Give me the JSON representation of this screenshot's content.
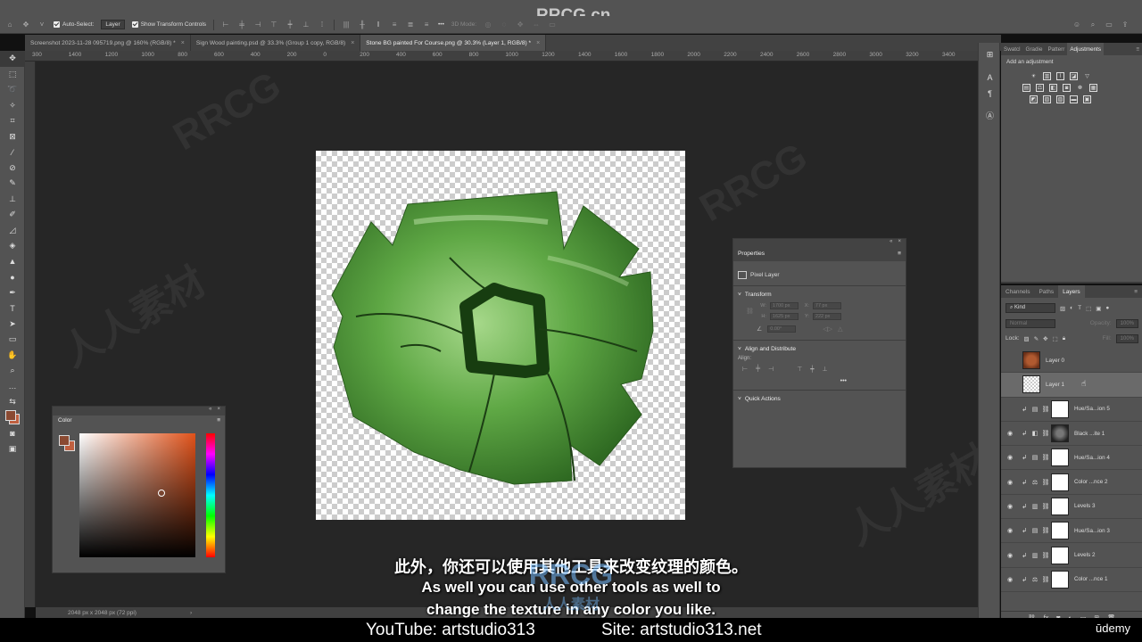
{
  "watermark": {
    "top": "RRCG.cn",
    "center_line1": "RRCG",
    "center_line2": "人人素材",
    "diag": "RRCG",
    "diag_cn": "人人素材"
  },
  "options_bar": {
    "auto_select_label": "Auto-Select:",
    "auto_select_value": "Layer",
    "show_transform_label": "Show Transform Controls",
    "three_d_mode": "3D Mode:",
    "more": "•••"
  },
  "tabs": [
    {
      "label": "Screenshot 2023-11-28 095719.png @ 160% (RGB/8) *",
      "close": "×"
    },
    {
      "label": "Sign Wood painting.psd @ 33.3% (Group 1 copy, RGB/8)",
      "close": "×"
    },
    {
      "label": "Stone BG painted For Course.png @ 30.3% (Layer 1, RGB/8) *",
      "close": "×"
    }
  ],
  "ruler_ticks": [
    "300",
    "1400",
    "1200",
    "1000",
    "800",
    "600",
    "400",
    "200",
    "0",
    "200",
    "400",
    "600",
    "800",
    "1000",
    "1200",
    "1400",
    "1600",
    "1800",
    "2000",
    "2200",
    "2400",
    "2600",
    "2800",
    "3000",
    "3200",
    "3400"
  ],
  "status": {
    "doc_size": "2048 px x 2048 px (72 ppi)",
    "arrow": "›"
  },
  "color_panel": {
    "title": "Color",
    "collapse": "«",
    "close": "×",
    "menu": "≡"
  },
  "properties": {
    "title": "Properties",
    "pixel_layer": "Pixel Layer",
    "transform": "Transform",
    "w_label": "W:",
    "w_value": "1700 px",
    "x_label": "X:",
    "x_value": "77 px",
    "h_label": "H:",
    "h_value": "1625 px",
    "y_label": "Y:",
    "y_value": "222 px",
    "angle_value": "0.00°",
    "align_distribute": "Align and Distribute",
    "align_label": "Align:",
    "more": "•••",
    "quick_actions": "Quick Actions",
    "collapse": "«",
    "close": "×",
    "menu": "≡"
  },
  "adjustments": {
    "tabs": [
      "Swatcl",
      "Gradie",
      "Patterr",
      "Adjustments"
    ],
    "add_label": "Add an adjustment",
    "menu": "≡"
  },
  "layers": {
    "tabs": [
      "Channels",
      "Paths",
      "Layers"
    ],
    "filter_kind": "Kind",
    "blend_mode": "Normal",
    "opacity_label": "Opacity:",
    "opacity_value": "100%",
    "lock_label": "Lock:",
    "fill_label": "Fill:",
    "fill_value": "100%",
    "menu": "≡",
    "items": [
      {
        "name": "Layer 0",
        "thumb": "orange",
        "visible": false,
        "adj": ""
      },
      {
        "name": "Layer 1",
        "thumb": "check",
        "visible": false,
        "adj": "",
        "selected": true
      },
      {
        "name": "Hue/Sa...ion 5",
        "thumb": "white",
        "visible": false,
        "adj": "hue"
      },
      {
        "name": "Black ...ite 1",
        "thumb": "dark",
        "visible": true,
        "adj": "bw"
      },
      {
        "name": "Hue/Sa...ion 4",
        "thumb": "white",
        "visible": true,
        "adj": "hue"
      },
      {
        "name": "Color ...nce 2",
        "thumb": "white",
        "visible": true,
        "adj": "balance"
      },
      {
        "name": "Levels 3",
        "thumb": "white",
        "visible": true,
        "adj": "levels"
      },
      {
        "name": "Hue/Sa...ion 3",
        "thumb": "white",
        "visible": true,
        "adj": "hue"
      },
      {
        "name": "Levels 2",
        "thumb": "white",
        "visible": true,
        "adj": "levels"
      },
      {
        "name": "Color ...nce 1",
        "thumb": "white",
        "visible": true,
        "adj": "balance"
      }
    ]
  },
  "subtitles": {
    "cn": "此外，你还可以使用其他工具来改变纹理的颜色。",
    "en1": "As well you can use other tools as well to",
    "en2": "change the texture in any color you like."
  },
  "footer": {
    "youtube": "YouTube: artstudio313",
    "site": "Site: artstudio313.net",
    "udemy": "ūdemy"
  },
  "colors": {
    "foreground": "#8a4a32",
    "accent_hue": "#e0521a"
  }
}
